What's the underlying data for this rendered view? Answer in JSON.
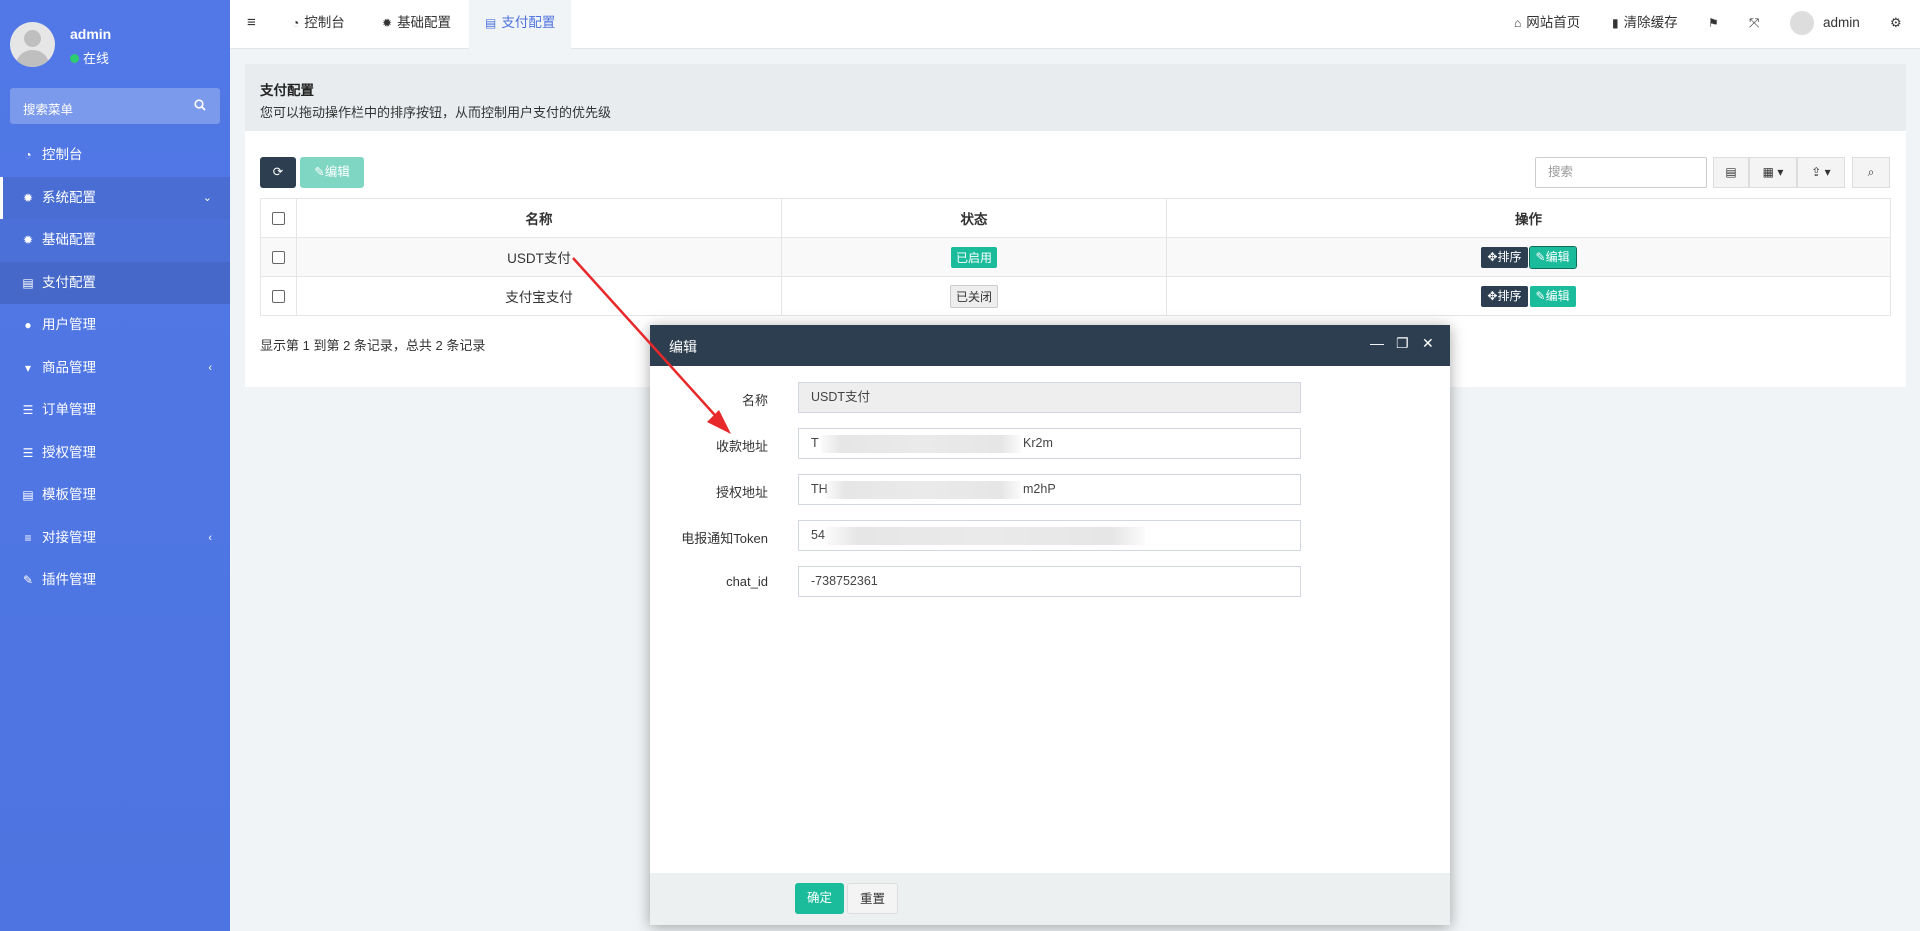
{
  "sidebar": {
    "user": {
      "name": "admin",
      "status": "在线"
    },
    "search_placeholder": "搜索菜单",
    "items": [
      {
        "label": "控制台"
      },
      {
        "label": "系统配置"
      },
      {
        "label": "基础配置"
      },
      {
        "label": "支付配置"
      },
      {
        "label": "用户管理"
      },
      {
        "label": "商品管理"
      },
      {
        "label": "订单管理"
      },
      {
        "label": "授权管理"
      },
      {
        "label": "模板管理"
      },
      {
        "label": "对接管理"
      },
      {
        "label": "插件管理"
      }
    ]
  },
  "topnav": {
    "tabs": [
      {
        "label": "控制台"
      },
      {
        "label": "基础配置"
      },
      {
        "label": "支付配置"
      }
    ],
    "home": "网站首页",
    "clear_cache": "清除缓存",
    "user": "admin"
  },
  "page": {
    "title": "支付配置",
    "description": "您可以拖动操作栏中的排序按钮，从而控制用户支付的优先级"
  },
  "toolbar": {
    "edit_label": "编辑",
    "search_placeholder": "搜索"
  },
  "table": {
    "headers": {
      "name": "名称",
      "status": "状态",
      "actions": "操作"
    },
    "rows": [
      {
        "name": "USDT支付",
        "status": "已启用",
        "sort": "排序",
        "edit": "编辑"
      },
      {
        "name": "支付宝支付",
        "status": "已关闭",
        "sort": "排序",
        "edit": "编辑"
      }
    ],
    "pager": "显示第 1 到第 2 条记录，总共 2 条记录"
  },
  "dialog": {
    "title": "编辑",
    "fields": {
      "name": {
        "label": "名称",
        "value": "USDT支付"
      },
      "receive_address": {
        "label": "收款地址",
        "prefix": "T",
        "suffix": "Kr2m"
      },
      "auth_address": {
        "label": "授权地址",
        "prefix": "TH",
        "suffix": "m2hP"
      },
      "token": {
        "label": "电报通知Token",
        "prefix": "54"
      },
      "chat_id": {
        "label": "chat_id",
        "value": "-738752361"
      }
    },
    "ok_label": "确定",
    "reset_label": "重置"
  },
  "colors": {
    "sidebar": "#4e73df",
    "dark": "#2c3e50",
    "success": "#1abc9c",
    "annotation_arrow": "#e8292b"
  }
}
